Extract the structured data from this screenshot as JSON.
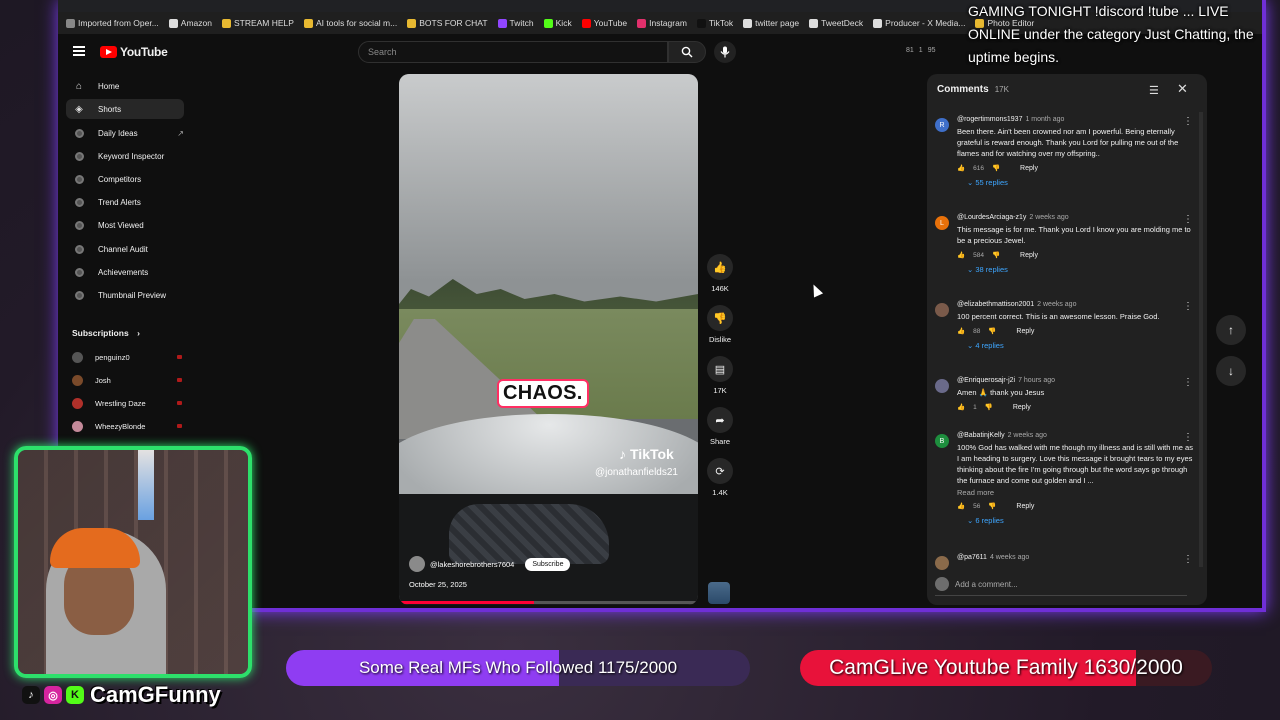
{
  "bookmarks": [
    {
      "label": "Imported from Oper...",
      "color": "#888888"
    },
    {
      "label": "Amazon",
      "color": "#dddddd"
    },
    {
      "label": "STREAM HELP",
      "color": "#e8b931"
    },
    {
      "label": "AI tools for social m...",
      "color": "#e8b931"
    },
    {
      "label": "BOTS FOR CHAT",
      "color": "#e8b931"
    },
    {
      "label": "Twitch",
      "color": "#9146ff"
    },
    {
      "label": "Kick",
      "color": "#53fc18"
    },
    {
      "label": "YouTube",
      "color": "#ff0000"
    },
    {
      "label": "Instagram",
      "color": "#e1306c"
    },
    {
      "label": "TikTok",
      "color": "#111111"
    },
    {
      "label": "twitter page",
      "color": "#dddddd"
    },
    {
      "label": "TweetDeck",
      "color": "#dddddd"
    },
    {
      "label": "Producer - X Media...",
      "color": "#dddddd"
    },
    {
      "label": "Photo Editor",
      "color": "#e8b931"
    }
  ],
  "header": {
    "logo_text": "YouTube",
    "search_placeholder": "Search",
    "stats": [
      "81",
      "1",
      "95"
    ]
  },
  "sidebar": {
    "items": [
      {
        "label": "Home",
        "icon": "home-icon",
        "active": false
      },
      {
        "label": "Shorts",
        "icon": "shorts-icon",
        "active": true
      },
      {
        "label": "Daily Ideas",
        "icon": "dot-icon",
        "active": false
      },
      {
        "label": "Keyword Inspector",
        "icon": "dot-icon",
        "active": false
      },
      {
        "label": "Competitors",
        "icon": "dot-icon",
        "active": false
      },
      {
        "label": "Trend Alerts",
        "icon": "dot-icon",
        "active": false
      },
      {
        "label": "Most Viewed",
        "icon": "dot-icon",
        "active": false
      },
      {
        "label": "Channel Audit",
        "icon": "dot-icon",
        "active": false
      },
      {
        "label": "Achievements",
        "icon": "dot-icon",
        "active": false
      },
      {
        "label": "Thumbnail Preview",
        "icon": "dot-icon",
        "active": false
      }
    ],
    "subscriptions_label": "Subscriptions",
    "subscriptions": [
      {
        "name": "penguinz0",
        "color": "#555555"
      },
      {
        "name": "Josh",
        "color": "#7a4a2a"
      },
      {
        "name": "Wrestling Daze",
        "color": "#b0302a"
      },
      {
        "name": "WheezyBlonde",
        "color": "#c48a9a"
      }
    ]
  },
  "video": {
    "caption": "CHAOS.",
    "watermark": "TikTok",
    "watermark_handle": "@jonathanfields21",
    "channel": "@lakeshorebrothers7604",
    "subscribe_label": "Subscribe",
    "date": "October 25, 2025",
    "progress_fraction": 0.45
  },
  "actions": {
    "like_count": "146K",
    "dislike_label": "Dislike",
    "comments_count": "17K",
    "share_label": "Share",
    "remix_count": "1.4K"
  },
  "comments": {
    "title": "Comments",
    "count": "17K",
    "add_placeholder": "Add a comment...",
    "items": [
      {
        "author": "@rogertimmons1937",
        "time": "1 month ago",
        "avatar_letter": "R",
        "avatar_color": "#3f6fc9",
        "text": "Been there.  Ain't been crowned nor am I powerful.  Being eternally grateful is reward enough.  Thank you Lord for pulling me out of the flames and for watching over my offspring..",
        "likes": "616",
        "replies": "55 replies",
        "read_more": ""
      },
      {
        "author": "@LourdesArciaga-z1y",
        "time": "2 weeks ago",
        "avatar_letter": "L",
        "avatar_color": "#e8710a",
        "text": "This message is for me. Thank you Lord I know you are molding me to be a precious Jewel.",
        "likes": "584",
        "replies": "38 replies",
        "read_more": ""
      },
      {
        "author": "@elizabethmattison2001",
        "time": "2 weeks ago",
        "avatar_letter": "",
        "avatar_color": "#7a5a4a",
        "text": "100 percent correct. This is an awesome lesson. Praise God.",
        "likes": "88",
        "replies": "4 replies",
        "read_more": ""
      },
      {
        "author": "@Enriquerosajr-j2i",
        "time": "7 hours ago",
        "avatar_letter": "",
        "avatar_color": "#6a6a8a",
        "text": "Amen 🙏 thank you Jesus",
        "likes": "1",
        "replies": "",
        "read_more": ""
      },
      {
        "author": "@BabatinjKelly",
        "time": "2 weeks ago",
        "avatar_letter": "B",
        "avatar_color": "#1e8e3e",
        "text": "100% God has walked with me though my illness and is still with me as I am heading to surgery. Love this message it brought tears to my eyes thinking about the fire I'm going through but the word says go through the furnace and come out golden and I ...",
        "likes": "56",
        "replies": "6 replies",
        "read_more": "Read more"
      },
      {
        "author": "@pa7611",
        "time": "4 weeks ago",
        "avatar_letter": "",
        "avatar_color": "#8a6a4a",
        "text": "",
        "likes": "",
        "replies": "",
        "read_more": ""
      }
    ]
  },
  "overlay": {
    "ticker": "GAMING TONIGHT !discord !tube ... LIVE ONLINE under the category Just Chatting, the uptime begins.",
    "cam_name": "CamGFunny",
    "goal1": {
      "label": "Some Real MFs Who Followed 1175/2000",
      "current": 1175,
      "target": 2000,
      "color": "#8f3df2"
    },
    "goal2": {
      "label": "CamGLive Youtube Family 1630/2000",
      "current": 1630,
      "target": 2000,
      "color": "#e8123a"
    }
  }
}
